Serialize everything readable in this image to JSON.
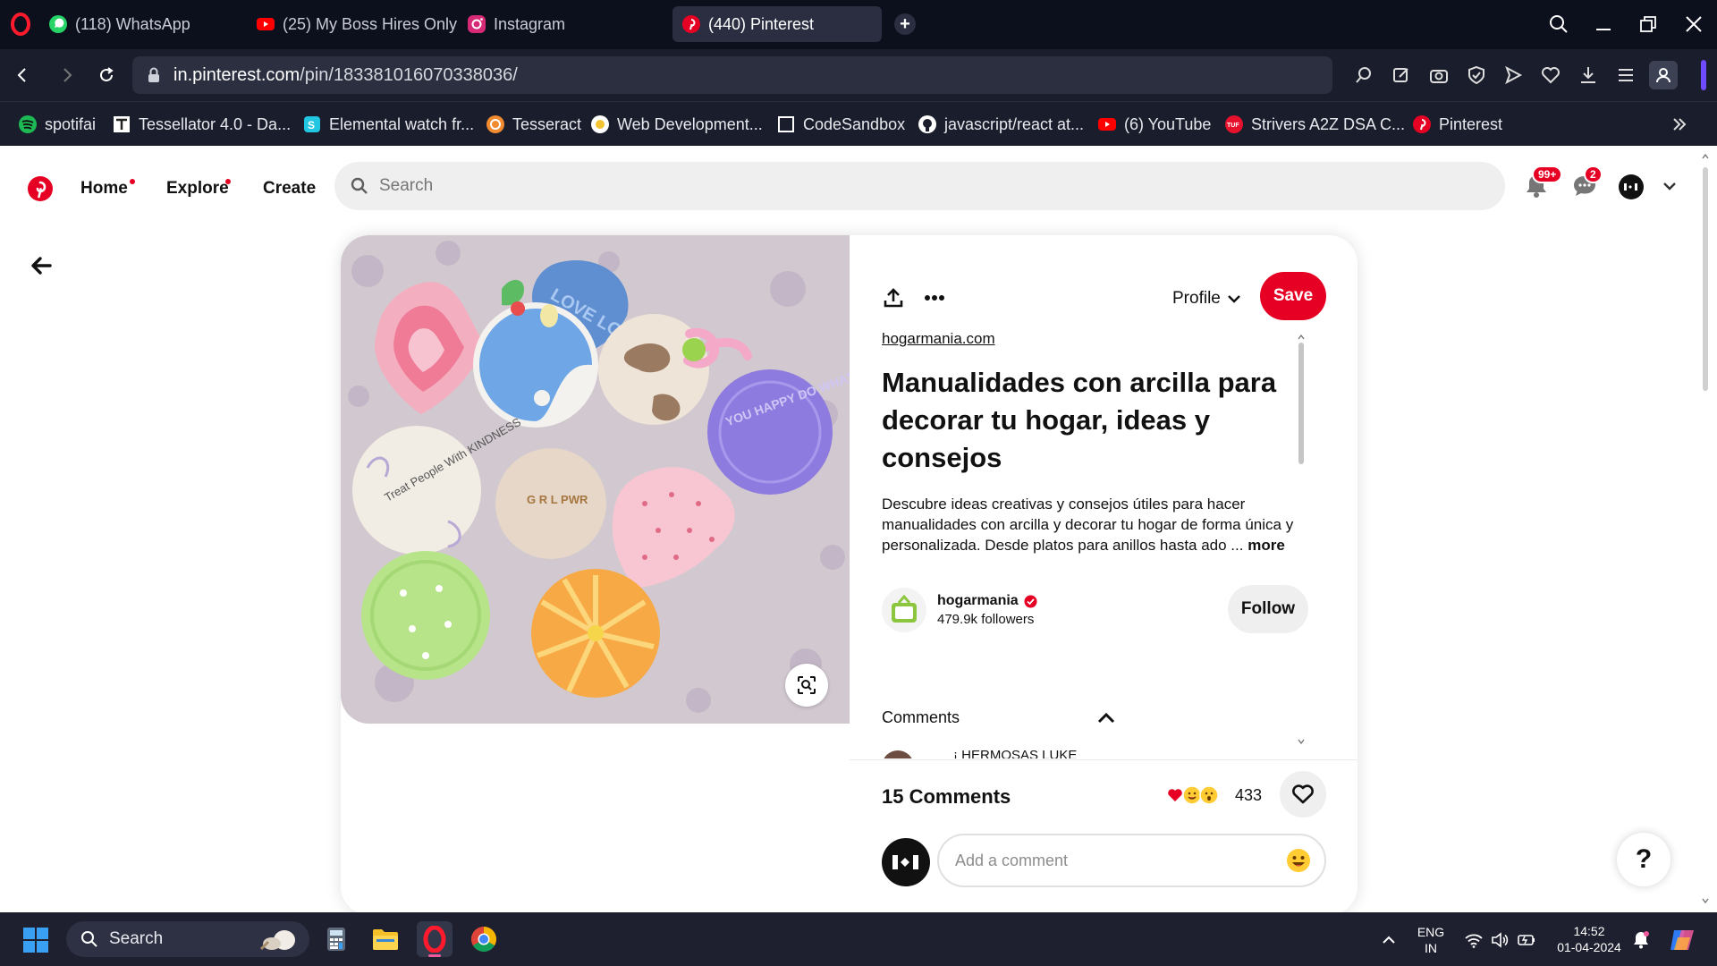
{
  "browser": {
    "tabs": [
      {
        "label": "(118) WhatsApp",
        "icon": "whatsapp-icon"
      },
      {
        "label": "(25) My Boss Hires Only",
        "icon": "youtube-icon"
      },
      {
        "label": "Instagram",
        "icon": "instagram-icon"
      },
      {
        "label": "(440) Pinterest",
        "icon": "pinterest-icon",
        "active": true
      }
    ],
    "url_domain": "in.pinterest.com",
    "url_path": "/pin/183381016070338036/",
    "bookmarks": [
      {
        "label": "spotifai",
        "icon": "spotify-icon"
      },
      {
        "label": "Tessellator 4.0 - Da...",
        "icon": "tessellator-icon"
      },
      {
        "label": "Elemental watch fr...",
        "icon": "elemental-icon"
      },
      {
        "label": "Tesseract",
        "icon": "tesseract-icon"
      },
      {
        "label": "Web Development...",
        "icon": "webdev-icon"
      },
      {
        "label": "CodeSandbox",
        "icon": "codesandbox-icon"
      },
      {
        "label": "javascript/react at...",
        "icon": "github-icon"
      },
      {
        "label": "(6) YouTube",
        "icon": "youtube-icon"
      },
      {
        "label": "Strivers A2Z DSA C...",
        "icon": "striver-icon"
      },
      {
        "label": "Pinterest",
        "icon": "pinterest-icon"
      }
    ]
  },
  "header": {
    "nav": [
      "Home",
      "Explore",
      "Create"
    ],
    "search_placeholder": "Search",
    "notifications_badge": "99+",
    "messages_badge": "2"
  },
  "pin": {
    "profile_label": "Profile",
    "save_label": "Save",
    "source": "hogarmania.com",
    "title": "Manualidades con arcilla para decorar tu hogar, ideas y consejos",
    "description": "Descubre ideas creativas y consejos útiles para hacer manualidades con arcilla y decorar tu hogar de forma única y personalizada. Desde platos para anillos hasta ado ...",
    "more_label": "more",
    "creator_name": "hogarmania",
    "creator_followers": "479.9k followers",
    "follow_label": "Follow",
    "comments_label": "Comments",
    "comment_preview": "¡ HERMOSAS LUKE",
    "comments_count": "15 Comments",
    "reaction_count": "433",
    "comment_placeholder": "Add a comment",
    "help": "?"
  },
  "plates_text": {
    "kindness": "Treat People With KINDNESS",
    "girl_pwr": "G R L PWR",
    "love": "LOVE LOVE LOVE",
    "happy": "YOU HAPPY DO WHAT MAKES"
  },
  "taskbar": {
    "search_label": "Search",
    "lang_top": "ENG",
    "lang_bottom": "IN",
    "time": "14:52",
    "date": "01-04-2024"
  },
  "colors": {
    "pinterest_red": "#e60023",
    "chrome_dark": "#0c0f1c",
    "toolbar": "#1a1d2b"
  }
}
